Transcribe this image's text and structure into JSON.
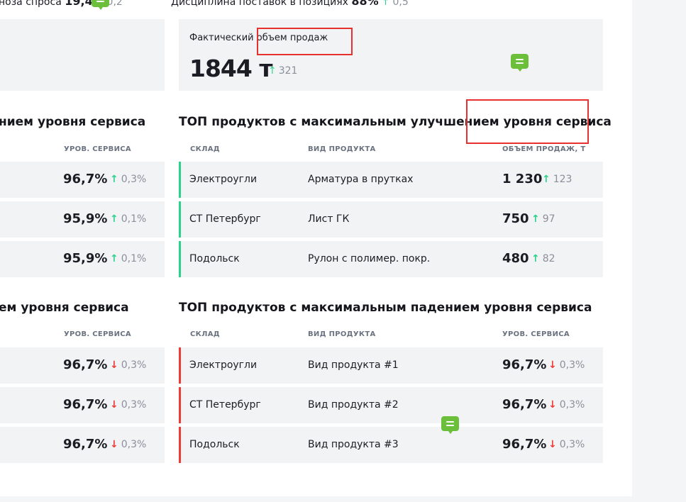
{
  "topline": {
    "left_text": "ноза спроса",
    "left_value": "19,4",
    "left_delta": "0,2",
    "right_text": "Дисциплина поставок в позициях",
    "right_value": "88%",
    "right_delta": "0,5"
  },
  "sales_card": {
    "label": "Фактический объем продаж",
    "value": "1844 т",
    "delta": "321"
  },
  "left_top_section": {
    "title": "нием уровня сервиса",
    "col_header": "УРОВ. СЕРВИСА",
    "rows": [
      {
        "value": "96,7%",
        "delta": "0,3%"
      },
      {
        "value": "95,9%",
        "delta": "0,1%"
      },
      {
        "value": "95,9%",
        "delta": "0,1%"
      }
    ]
  },
  "improvement_section": {
    "title": "ТОП продуктов с максимальным улучшением уровня сервиса",
    "col_warehouse": "СКЛАД",
    "col_product": "ВИД ПРОДУКТА",
    "col_value": "ОБЪЕМ ПРОДАЖ, Т",
    "rows": [
      {
        "warehouse": "Электроугли",
        "product": "Арматура в прутках",
        "value": "1 230",
        "delta": "123"
      },
      {
        "warehouse": "СТ Петербург",
        "product": "Лист ГК",
        "value": "750",
        "delta": "97"
      },
      {
        "warehouse": "Подольск",
        "product": "Рулон с полимер. покр.",
        "value": "480",
        "delta": "82"
      }
    ]
  },
  "left_bottom_section": {
    "title": "ем уровня сервиса",
    "col_header": "УРОВ. СЕРВИСА",
    "rows": [
      {
        "value": "96,7%",
        "delta": "0,3%"
      },
      {
        "value": "96,7%",
        "delta": "0,3%"
      },
      {
        "value": "96,7%",
        "delta": "0,3%"
      }
    ]
  },
  "decline_section": {
    "title": "ТОП продуктов с максимальным падением уровня сервиса",
    "col_warehouse": "СКЛАД",
    "col_product": "ВИД ПРОДУКТА",
    "col_value": "УРОВ. СЕРВИСА",
    "rows": [
      {
        "warehouse": "Электроугли",
        "product": "Вид продукта #1",
        "value": "96,7%",
        "delta": "0,3%"
      },
      {
        "warehouse": "СТ Петербург",
        "product": "Вид продукта #2",
        "value": "96,7%",
        "delta": "0,3%"
      },
      {
        "warehouse": "Подольск",
        "product": "Вид продукта #3",
        "value": "96,7%",
        "delta": "0,3%"
      }
    ]
  },
  "arrows": {
    "up": "↑",
    "down": "↓"
  },
  "colors": {
    "positive": "#2ad38a",
    "negative": "#ef3b36",
    "highlight": "#e8312f",
    "comment": "#6bbf3a"
  }
}
